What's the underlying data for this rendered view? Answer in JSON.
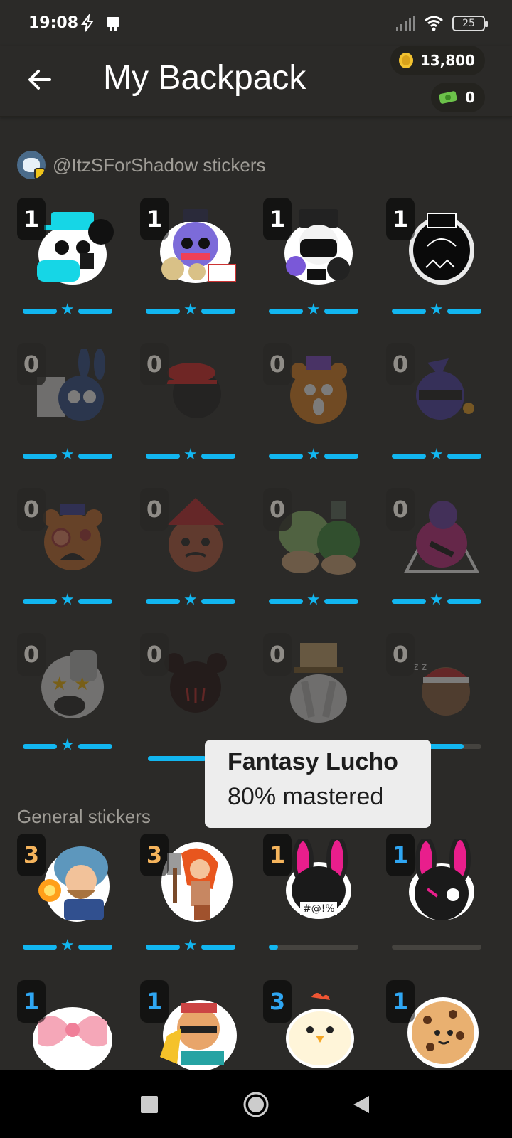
{
  "status_bar": {
    "time": "19:08",
    "battery": "25",
    "icons": [
      "flash-icon",
      "notification-icon",
      "signal-icon",
      "wifi-icon",
      "battery-icon"
    ]
  },
  "header": {
    "title": "My Backpack",
    "coins": "13,800",
    "cash": "0"
  },
  "sections": [
    {
      "title": "@ItzSForShadow stickers"
    },
    {
      "title": "General stickers"
    }
  ],
  "stickers": [
    {
      "count": "1",
      "count_color": "white",
      "faded": false,
      "progress": "star",
      "art": "mascot-cyan-hat"
    },
    {
      "count": "1",
      "count_color": "white",
      "faded": false,
      "progress": "star",
      "art": "cat-real-fabri"
    },
    {
      "count": "1",
      "count_color": "white",
      "faded": false,
      "progress": "star",
      "art": "mascot-starry-hat"
    },
    {
      "count": "1",
      "count_color": "white",
      "faded": false,
      "progress": "star",
      "art": "black-bear-chains"
    },
    {
      "count": "0",
      "count_color": "grey",
      "faded": true,
      "progress": "star",
      "art": "bunny-paper"
    },
    {
      "count": "0",
      "count_color": "grey",
      "faded": true,
      "progress": "star",
      "art": "red-cap"
    },
    {
      "count": "0",
      "count_color": "grey",
      "faded": true,
      "progress": "star",
      "art": "orange-bear-scared"
    },
    {
      "count": "0",
      "count_color": "grey",
      "faded": true,
      "progress": "star",
      "art": "purple-mask"
    },
    {
      "count": "0",
      "count_color": "grey",
      "faded": true,
      "progress": "star",
      "art": "hypno-bear"
    },
    {
      "count": "0",
      "count_color": "grey",
      "faded": true,
      "progress": "star",
      "art": "red-hat-bear"
    },
    {
      "count": "0",
      "count_color": "grey",
      "faded": true,
      "progress": "star",
      "art": "green-bombs"
    },
    {
      "count": "0",
      "count_color": "grey",
      "faded": true,
      "progress": "star",
      "art": "pink-witch"
    },
    {
      "count": "0",
      "count_color": "grey",
      "faded": true,
      "progress": "star",
      "art": "star-eyes-bear"
    },
    {
      "count": "0",
      "count_color": "grey",
      "faded": true,
      "progress": "none",
      "art": "dark-bear"
    },
    {
      "count": "0",
      "count_color": "grey",
      "faded": true,
      "progress": "none",
      "art": "top-hat-hands"
    },
    {
      "count": "0",
      "count_color": "grey",
      "faded": true,
      "progress": "bar",
      "progress_value": 0.8,
      "art": "sleepy-santa"
    },
    {
      "count": "3",
      "count_color": "gold",
      "faded": false,
      "progress": "star",
      "art": "wizard"
    },
    {
      "count": "3",
      "count_color": "gold",
      "faded": false,
      "progress": "star",
      "art": "valkyrie"
    },
    {
      "count": "1",
      "count_color": "gold",
      "faded": false,
      "progress": "bar",
      "progress_value": 0.1,
      "art": "bunny-angry"
    },
    {
      "count": "1",
      "count_color": "blue",
      "faded": false,
      "progress": "bar",
      "progress_value": 0.0,
      "art": "bunny-wink"
    },
    {
      "count": "1",
      "count_color": "blue",
      "faded": false,
      "progress": "none",
      "art": "pink-bow"
    },
    {
      "count": "1",
      "count_color": "blue",
      "faded": false,
      "progress": "none",
      "art": "bold-guy"
    },
    {
      "count": "3",
      "count_color": "blue",
      "faded": false,
      "progress": "none",
      "art": "chick"
    },
    {
      "count": "1",
      "count_color": "blue",
      "faded": false,
      "progress": "none",
      "art": "cookie"
    }
  ],
  "tooltip": {
    "name": "Fantasy Lucho",
    "mastery": "80% mastered",
    "mastery_value": 0.8
  },
  "colors": {
    "background": "#2b2a28",
    "accent": "#12b6f0",
    "gold": "#f5b45c",
    "blue": "#2fa6f2"
  }
}
